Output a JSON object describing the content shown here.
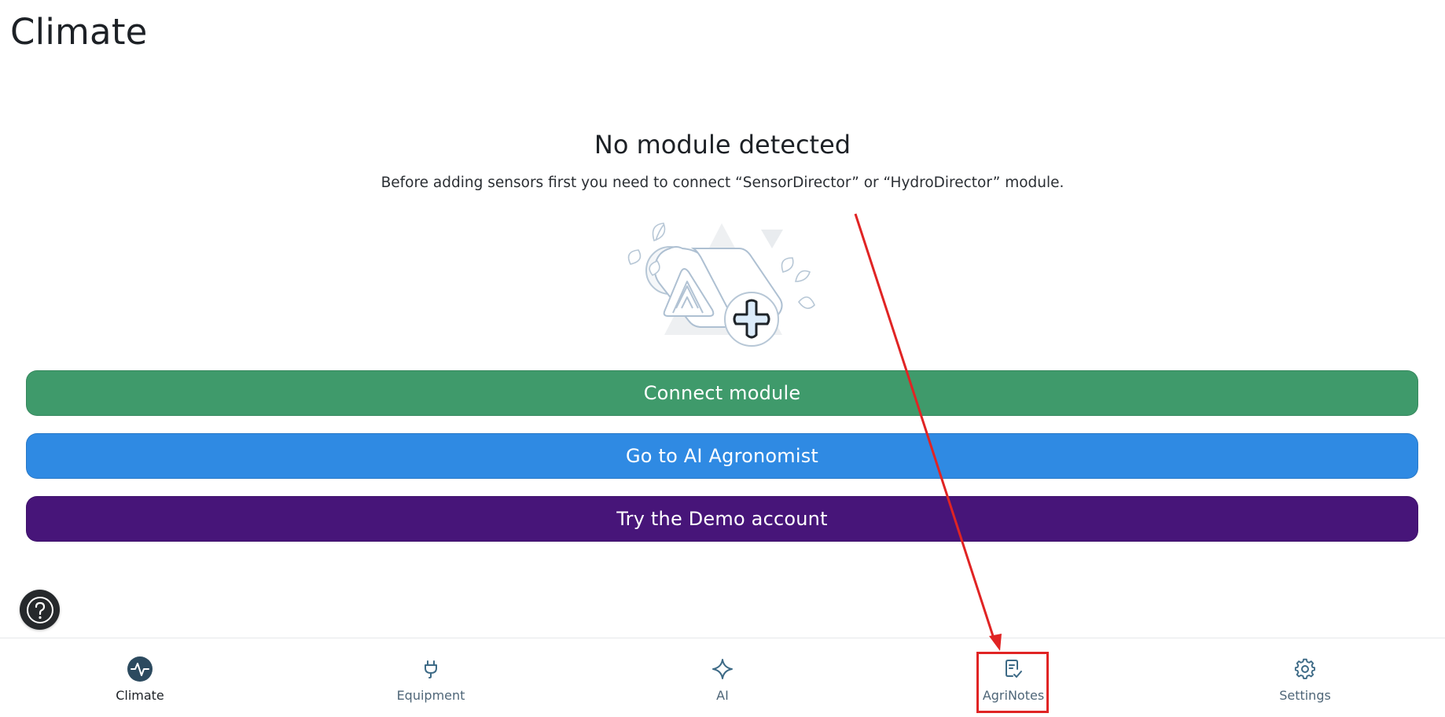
{
  "page": {
    "title": "Climate"
  },
  "empty_state": {
    "heading": "No module detected",
    "description": "Before adding sensors first you need to connect “SensorDirector” or “HydroDirector” module."
  },
  "actions": {
    "connect_label": "Connect module",
    "ai_label": "Go to AI Agronomist",
    "demo_label": "Try the Demo account"
  },
  "colors": {
    "connect": "#3f9a6b",
    "ai": "#2f8ae3",
    "demo": "#471579",
    "annotation": "#e02424"
  },
  "help": {
    "icon": "help-circle-icon"
  },
  "bottom_nav": {
    "active": "Climate",
    "items": [
      {
        "label": "Climate",
        "icon": "pulse-icon"
      },
      {
        "label": "Equipment",
        "icon": "plug-icon"
      },
      {
        "label": "AI",
        "icon": "sparkle-icon"
      },
      {
        "label": "AgriNotes",
        "icon": "note-check-icon"
      },
      {
        "label": "Settings",
        "icon": "gear-icon"
      }
    ]
  }
}
